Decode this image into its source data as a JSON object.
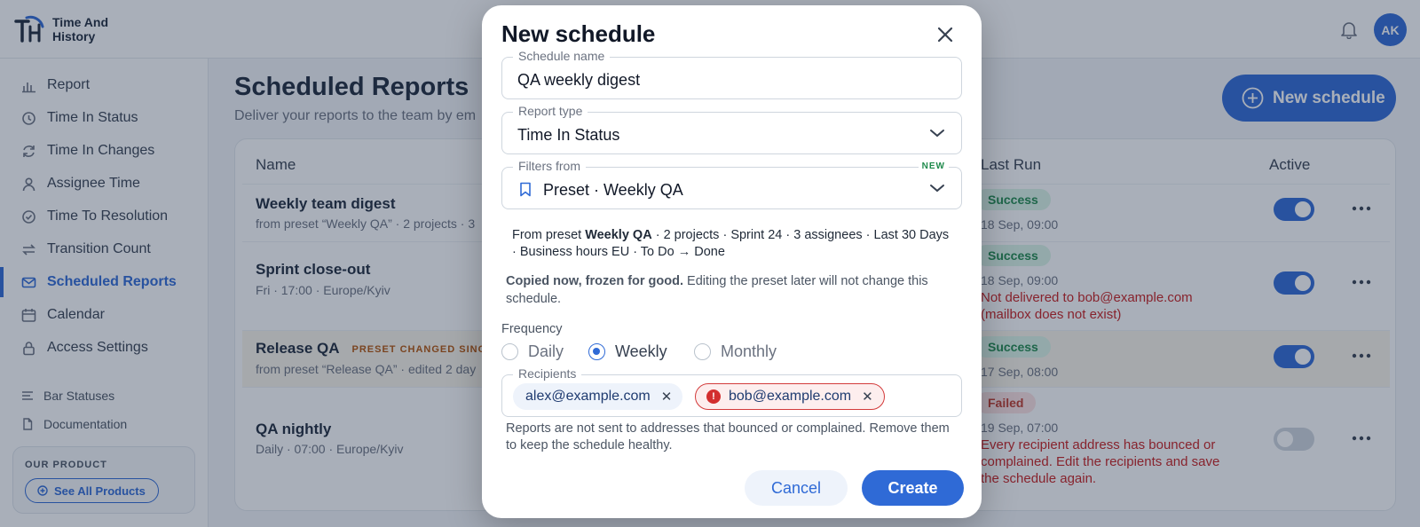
{
  "app": {
    "brand_line1": "Time And",
    "brand_line2": "History",
    "avatar": "AK"
  },
  "sidebar": {
    "items": [
      {
        "label": "Report",
        "icon": "bar-chart-icon"
      },
      {
        "label": "Time In Status",
        "icon": "clock-icon"
      },
      {
        "label": "Time In Changes",
        "icon": "refresh-icon"
      },
      {
        "label": "Assignee Time",
        "icon": "user-icon"
      },
      {
        "label": "Time To Resolution",
        "icon": "check-circle-icon"
      },
      {
        "label": "Transition Count",
        "icon": "arrows-icon"
      },
      {
        "label": "Scheduled Reports",
        "icon": "mail-icon",
        "active": true
      },
      {
        "label": "Calendar",
        "icon": "calendar-icon"
      },
      {
        "label": "Access Settings",
        "icon": "lock-icon"
      }
    ],
    "secondary": [
      {
        "label": "Bar Statuses",
        "icon": "menu-icon"
      },
      {
        "label": "Documentation",
        "icon": "document-icon"
      }
    ],
    "product_title": "OUR PRODUCT",
    "see_all": "See All Products"
  },
  "main": {
    "title": "Scheduled Reports",
    "subtitle": "Deliver your reports to the team by em",
    "new_schedule": "New schedule",
    "columns": {
      "name": "Name",
      "last_run": "Last Run",
      "active": "Active"
    },
    "rows": [
      {
        "name": "Weekly team digest",
        "sub": "from preset “Weekly QA” · 2 projects · 3",
        "status": "Success",
        "time": "18 Sep, 09:00",
        "error": "",
        "active": true
      },
      {
        "name": "Sprint close-out",
        "sub": "Fri · 17:00 · Europe/Kyiv",
        "status": "Success",
        "time": "18 Sep, 09:00",
        "error": "Not delivered to bob@example.com (mailbox does not exist)",
        "active": true
      },
      {
        "name": "Release QA",
        "badge": "PRESET CHANGED SINCE",
        "sub": "from preset “Release QA” · edited 2 day",
        "status": "Success",
        "time": "17 Sep, 08:00",
        "error": "",
        "active": true
      },
      {
        "name": "QA nightly",
        "sub": "Daily · 07:00 · Europe/Kyiv",
        "status": "Failed",
        "time": "19 Sep, 07:00",
        "error": "Every recipient address has bounced or complained. Edit the recipients and save the schedule again.",
        "active": false
      }
    ]
  },
  "modal": {
    "title": "New schedule",
    "name_label": "Schedule name",
    "name_value": "QA weekly digest",
    "type_label": "Report type",
    "type_value": "Time In Status",
    "filters_label": "Filters from",
    "filters_new": "NEW",
    "filters_value": "Preset · Weekly QA",
    "preset_prefix": "From preset ",
    "preset_name": "Weekly QA",
    "preset_rest": " · 2 projects · Sprint 24 · 3 assignees · Last 30 Days · Business hours EU · To Do → Done",
    "frozen_bold": "Copied now, frozen for good.",
    "frozen_rest": " Editing the preset later will not change this schedule.",
    "frequency_label": "Frequency",
    "frequency_options": [
      "Daily",
      "Weekly",
      "Monthly"
    ],
    "frequency_selected": "Weekly",
    "recipients_label": "Recipients",
    "recipients": [
      {
        "email": "alex@example.com",
        "bounced": false
      },
      {
        "email": "bob@example.com",
        "bounced": true
      }
    ],
    "recipients_help": "Reports are not sent to addresses that bounced or complained. Remove them to keep the schedule healthy.",
    "cancel": "Cancel",
    "create": "Create"
  },
  "colors": {
    "accent": "#2f6ad6",
    "success": "#1f8a4c",
    "error": "#c81e1e",
    "warning": "#b45309"
  }
}
